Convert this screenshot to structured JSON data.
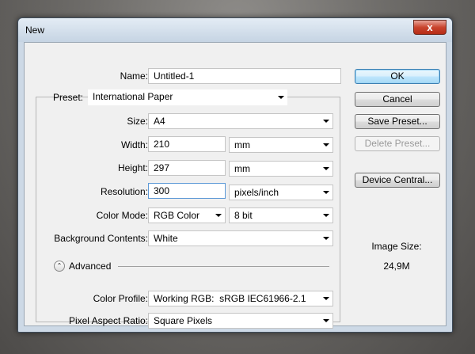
{
  "window": {
    "title": "New",
    "close_glyph": "x"
  },
  "form": {
    "name": {
      "label": "Name:",
      "value": "Untitled-1"
    },
    "preset": {
      "label": "Preset:",
      "value": "International Paper"
    },
    "size": {
      "label": "Size:",
      "value": "A4"
    },
    "width": {
      "label": "Width:",
      "value": "210",
      "unit": "mm"
    },
    "height": {
      "label": "Height:",
      "value": "297",
      "unit": "mm"
    },
    "resolution": {
      "label": "Resolution:",
      "value": "300",
      "unit": "pixels/inch"
    },
    "color_mode": {
      "label": "Color Mode:",
      "mode": "RGB Color",
      "depth": "8 bit"
    },
    "background": {
      "label": "Background Contents:",
      "value": "White"
    },
    "advanced": {
      "label": "Advanced"
    },
    "color_profile": {
      "label": "Color Profile:",
      "value": "Working RGB:  sRGB IEC61966-2.1"
    },
    "pixel_aspect": {
      "label": "Pixel Aspect Ratio:",
      "value": "Square Pixels"
    }
  },
  "buttons": {
    "ok": "OK",
    "cancel": "Cancel",
    "save_preset": "Save Preset...",
    "delete_preset": "Delete Preset...",
    "device_central": "Device Central..."
  },
  "image_size": {
    "label": "Image Size:",
    "value": "24,9M"
  },
  "icons": {
    "close": "close-icon",
    "dropdown": "chevron-down-icon",
    "advanced_toggle": "double-chevron-up-icon"
  },
  "colors": {
    "frame": "#cdd9e6",
    "close_button": "#c9452e",
    "default_button": "#bee6fd",
    "focus_border": "#5e9ad7"
  }
}
